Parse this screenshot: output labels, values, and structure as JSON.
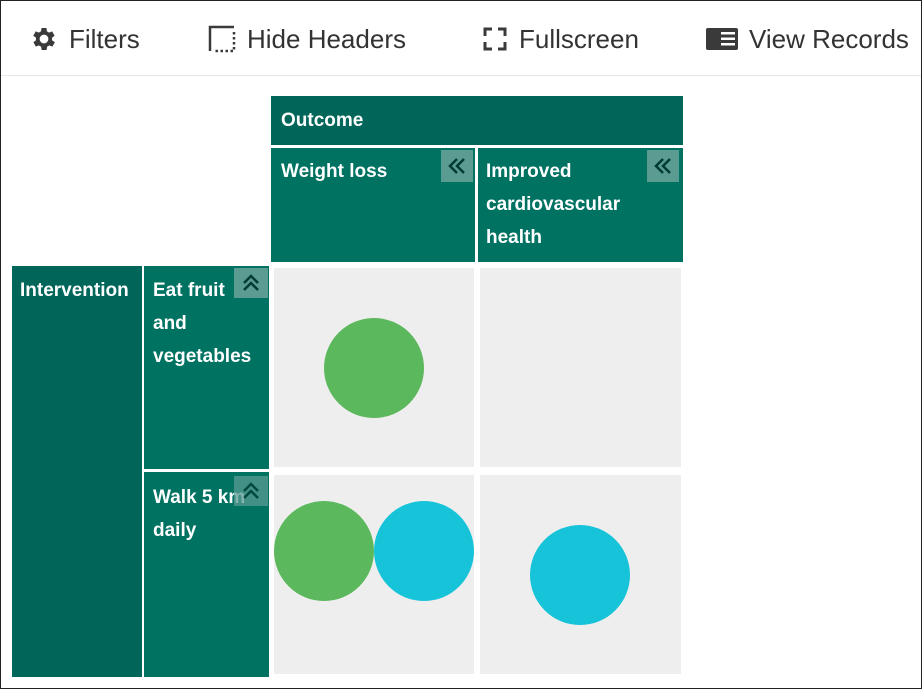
{
  "toolbar": {
    "filters_label": "Filters",
    "hide_headers_label": "Hide Headers",
    "fullscreen_label": "Fullscreen",
    "view_records_label": "View Records"
  },
  "columns": {
    "header": "Outcome",
    "items": [
      {
        "label": "Weight loss"
      },
      {
        "label_lines": [
          "Improved",
          "cardiovascular",
          "health"
        ]
      }
    ]
  },
  "rows": {
    "header": "Intervention",
    "items": [
      {
        "label_lines": [
          "Eat fruit",
          "and",
          "vegetables"
        ]
      },
      {
        "label_lines": [
          "Walk 5 km",
          "daily"
        ]
      }
    ]
  },
  "colors": {
    "header_dark": "#00665a",
    "header_mid": "#007262",
    "cell_bg": "#eeeeee",
    "marker_green": "#5cb85c",
    "marker_cyan": "#17c3d9"
  },
  "markers": {
    "eat_weightloss": [
      "green"
    ],
    "eat_cardio": [],
    "walk_weightloss": [
      "green",
      "cyan"
    ],
    "walk_cardio": [
      "cyan"
    ]
  }
}
